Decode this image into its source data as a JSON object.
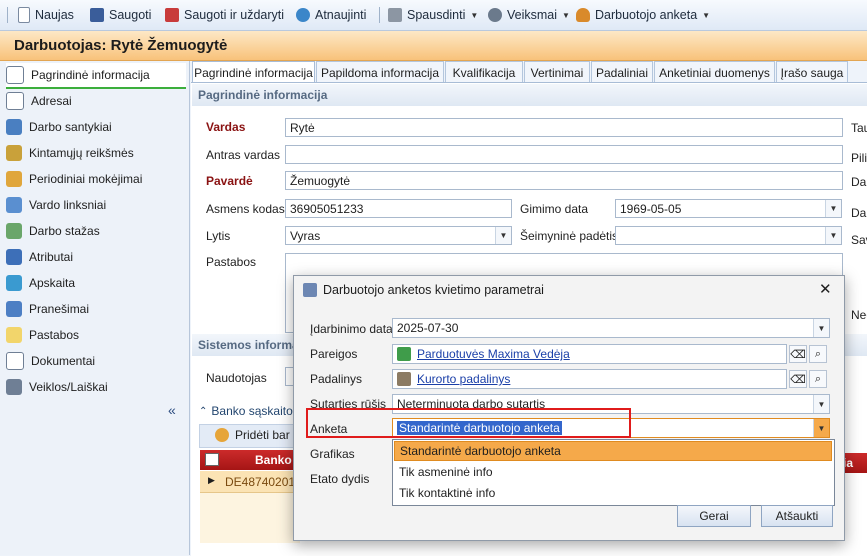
{
  "toolbar": {
    "items": [
      {
        "label": "Naujas",
        "icon": "document-icon"
      },
      {
        "label": "Saugoti",
        "icon": "save-icon"
      },
      {
        "label": "Saugoti ir uždaryti",
        "icon": "save-close-icon"
      },
      {
        "label": "Atnaujinti",
        "icon": "refresh-icon"
      },
      {
        "label": "Spausdinti",
        "icon": "print-icon"
      },
      {
        "label": "Veiksmai",
        "icon": "gear-icon"
      },
      {
        "label": "Darbuotojo anketa",
        "icon": "user-icon"
      }
    ]
  },
  "page": {
    "title": "Darbuotojas: Rytė Žemuogytė"
  },
  "sidebar": {
    "items": [
      {
        "label": "Pagrindinė informacija"
      },
      {
        "label": "Adresai"
      },
      {
        "label": "Darbo santykiai"
      },
      {
        "label": "Kintamųjų reikšmės"
      },
      {
        "label": "Periodiniai mokėjimai"
      },
      {
        "label": "Vardo linksniai"
      },
      {
        "label": "Darbo stažas"
      },
      {
        "label": "Atributai"
      },
      {
        "label": "Apskaita"
      },
      {
        "label": "Pranešimai"
      },
      {
        "label": "Pastabos"
      },
      {
        "label": "Dokumentai"
      },
      {
        "label": "Veiklos/Laiškai"
      }
    ],
    "collapse": "«"
  },
  "tabs": [
    {
      "label": "Pagrindinė informacija"
    },
    {
      "label": "Papildoma informacija"
    },
    {
      "label": "Kvalifikacija"
    },
    {
      "label": "Vertinimai"
    },
    {
      "label": "Padaliniai"
    },
    {
      "label": "Anketiniai duomenys"
    },
    {
      "label": "Įrašo sauga"
    }
  ],
  "main": {
    "section_title": "Pagrindinė informacija",
    "vardas_label": "Vardas",
    "vardas": "Rytė",
    "antras_label": "Antras vardas",
    "antras": "",
    "pavarde_label": "Pavardė",
    "pavarde": "Žemuogytė",
    "asmens_label": "Asmens kodas",
    "asmens": "36905051233",
    "gimimo_label": "Gimimo data",
    "gimimo": "1969-05-05",
    "lytis_label": "Lytis",
    "lytis": "Vyras",
    "seimynine_label": "Šeimyninė padėtis",
    "seimynine": "",
    "pastabos_label": "Pastabos",
    "right_labels": [
      "Tau",
      "Pilie",
      "Dar",
      "Dar",
      "Sav",
      "Neo"
    ],
    "sistemos_title": "Sistemos informa",
    "naudotojas_label": "Naudotojas",
    "banko_header": "Banko sąskaitos",
    "prideti": "Pridėti bar",
    "col_banko": "Banko s",
    "row_iban": "DE4874020102",
    "right_col_fragment": "ia"
  },
  "dialog": {
    "title": "Darbuotojo anketos kvietimo parametrai",
    "close": "✕",
    "fields": {
      "idarbinimo_label": "Įdarbinimo data",
      "idarbinimo": "2025-07-30",
      "pareigos_label": "Pareigos",
      "pareigos": "Parduotuvės Maxima Vedėja",
      "padalinys_label": "Padalinys",
      "padalinys": "Kurorto padalinys",
      "sutarties_label": "Sutarties rūšis",
      "sutarties": "Neterminuota darbo sutartis",
      "anketa_label": "Anketa",
      "anketa": "Standarintė darbuotojo anketa",
      "grafikas_label": "Grafikas",
      "etato_label": "Etato dydis"
    },
    "dropdown_options": [
      "Standarintė darbuotojo anketa",
      "Tik asmeninė info",
      "Tik kontaktinė info"
    ],
    "ok": "Gerai",
    "cancel": "Atšaukti"
  },
  "colors": {
    "highlight_red": "#e01b1b",
    "accent_orange": "#f5a94a",
    "title_bar": "#f8c27a"
  }
}
